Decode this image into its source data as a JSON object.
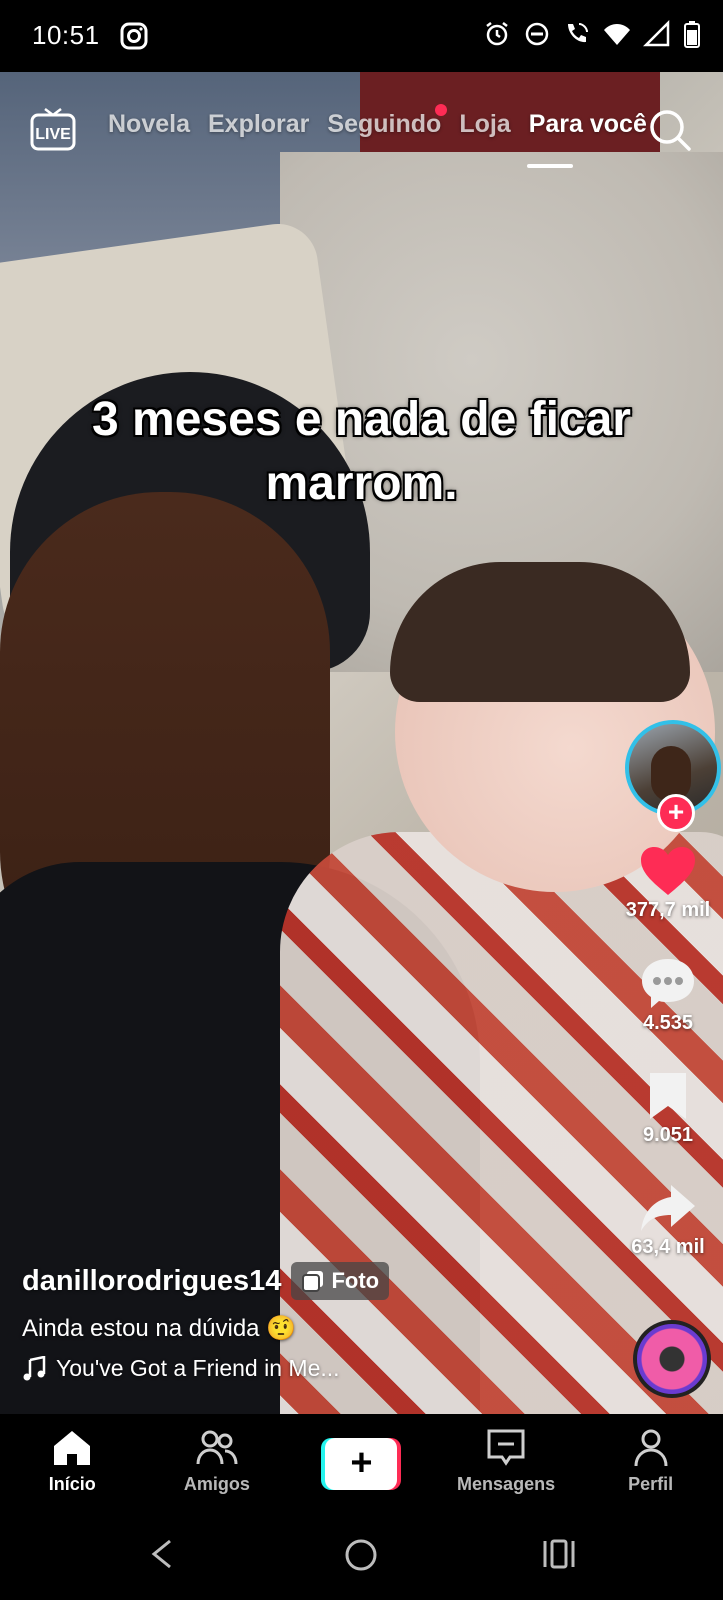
{
  "status_bar": {
    "time": "10:51",
    "left_icons": [
      "instagram-icon"
    ],
    "right_icons": [
      "alarm-icon",
      "do-not-disturb-icon",
      "wifi-calling-icon",
      "wifi-icon",
      "signal-icon",
      "battery-icon"
    ]
  },
  "top_nav": {
    "live_label": "LIVE",
    "tabs": [
      {
        "label": "Novela",
        "active": false
      },
      {
        "label": "Explorar",
        "active": false
      },
      {
        "label": "Seguindo",
        "active": false,
        "badge_dot": true
      },
      {
        "label": "Loja",
        "active": false
      },
      {
        "label": "Para você",
        "active": true
      }
    ]
  },
  "post": {
    "overlay_text": "3 meses e nada de ficar marrom.",
    "author": "danillorodrigues14",
    "type_badge": "Foto",
    "description": "Ainda estou na dúvida 🤨",
    "music": "You've Got a Friend in Me..."
  },
  "actions": {
    "likes": "377,7 mil",
    "comments": "4.535",
    "saves": "9.051",
    "shares": "63,4 mil"
  },
  "colors": {
    "accent": "#fe2c55",
    "avatar_ring": "#32c0e8",
    "create_left": "#25f4ee",
    "create_right": "#fe2c55"
  },
  "tab_bar": {
    "home": "Início",
    "friends": "Amigos",
    "messages": "Mensagens",
    "profile": "Perfil"
  }
}
